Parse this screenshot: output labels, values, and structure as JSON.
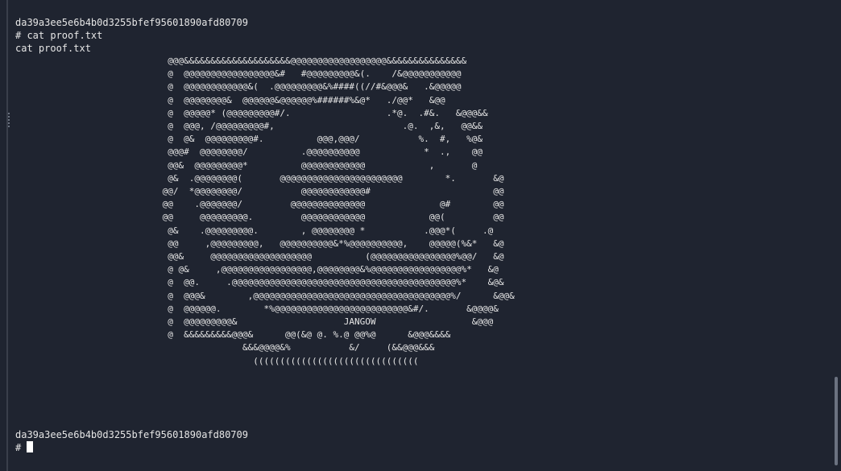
{
  "terminal": {
    "lines_top": [
      "da39a3ee5e6b4b0d3255bfef95601890afd80709",
      "# cat proof.txt",
      "cat proof.txt"
    ],
    "ascii_art": "  @@@&&&&&&&&&&&&&&&&&&&&@@@@@@@@@@@@@@@@@@&&&&&&&&&&&&&&&\n  @  @@@@@@@@@@@@@@@@@&#   #@@@@@@@@@&(.    /&@@@@@@@@@@@\n  @  @@@@@@@@@@@@&(  .@@@@@@@@@&%####((//#&@@@&   .&@@@@@\n  @  @@@@@@@@&  @@@@@@&@@@@@@%######%&@*   ./@@*   &@@\n  @  @@@@@* (@@@@@@@@@#/.                  .*@.  .#&.   &@@@&&\n  @  @@@, /@@@@@@@@@#,                        .@.  ,&,   @@&&\n  @  @&  @@@@@@@@@#.          @@@,@@@/           %.  #,   %@&\n  @@@#  @@@@@@@@/          .@@@@@@@@@@            *  .,    @@\n  @@&  @@@@@@@@@*          @@@@@@@@@@@@            ,       @\n  @&  .@@@@@@@@(       @@@@@@@@@@@@@@@@@@@@@@@        *.       &@\n @@/  *@@@@@@@@/           @@@@@@@@@@@@#                       @@\n @@    .@@@@@@@/         @@@@@@@@@@@@@@              @#        @@\n @@     @@@@@@@@@.         @@@@@@@@@@@@            @@(         @@\n  @&    .@@@@@@@@@.        , @@@@@@@@ *           .@@@*(     .@\n  @@     ,@@@@@@@@@,   @@@@@@@@@@&*%@@@@@@@@@@,    @@@@@(%&*   &@\n  @@&     @@@@@@@@@@@@@@@@@@@          (@@@@@@@@@@@@@@@@%@@/   &@\n  @ @&     ,@@@@@@@@@@@@@@@@@,@@@@@@@@&%@@@@@@@@@@@@@@@@@%*   &@\n  @  @@.     .@@@@@@@@@@@@@@@@@@@@@@@@@@@@@@@@@@@@@@@@@@%*    &@&\n  @  @@@&        ,@@@@@@@@@@@@@@@@@@@@@@@@@@@@@@@@@@@@@%/      &@@&\n  @  @@@@@@.        *%@@@@@@@@@@@@@@@@@@@@@@@@@&#/.       &@@@@&\n  @  @@@@@@@@@&                    JANGOW                  &@@@\n  @  &&&&&&&&&@@@&      @@(&@ @. %.@ @@%@      &@@@&&&&\n                &&&@@@@&%           &/     (&&@@@&&&\n                  (((((((((((((((((((((((((((((((",
    "lines_bottom": [
      "da39a3ee5e6b4b0d3255bfef95601890afd80709",
      "# "
    ]
  },
  "colors": {
    "background": "#1f2430",
    "text": "#e6e6e6",
    "cursor": "#ffffff"
  }
}
